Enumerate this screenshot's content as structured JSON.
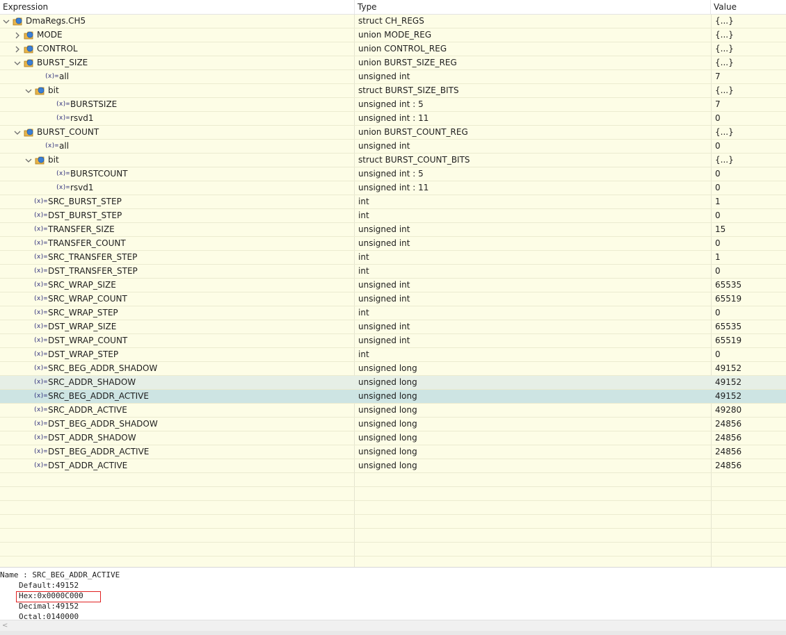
{
  "columns": {
    "expression": "Expression",
    "type": "Type",
    "value": "Value"
  },
  "rows": [
    {
      "name": "DmaRegs.CH5",
      "type": "struct CH_REGS",
      "value": "{...}",
      "depth": 0,
      "kind": "struct",
      "tw": "expanded"
    },
    {
      "name": "MODE",
      "type": "union MODE_REG",
      "value": "{...}",
      "depth": 1,
      "kind": "struct",
      "tw": "collapsed"
    },
    {
      "name": "CONTROL",
      "type": "union CONTROL_REG",
      "value": "{...}",
      "depth": 1,
      "kind": "struct",
      "tw": "collapsed"
    },
    {
      "name": "BURST_SIZE",
      "type": "union BURST_SIZE_REG",
      "value": "{...}",
      "depth": 1,
      "kind": "struct",
      "tw": "expanded"
    },
    {
      "name": "all",
      "type": "unsigned int",
      "value": "7",
      "depth": 2,
      "kind": "var",
      "tw": "none"
    },
    {
      "name": "bit",
      "type": "struct BURST_SIZE_BITS",
      "value": "{...}",
      "depth": 2,
      "kind": "struct",
      "tw": "expanded"
    },
    {
      "name": "BURSTSIZE",
      "type": "unsigned int : 5",
      "value": "7",
      "depth": 3,
      "kind": "var",
      "tw": "none"
    },
    {
      "name": "rsvd1",
      "type": "unsigned int : 11",
      "value": "0",
      "depth": 3,
      "kind": "var",
      "tw": "none"
    },
    {
      "name": "BURST_COUNT",
      "type": "union BURST_COUNT_REG",
      "value": "{...}",
      "depth": 1,
      "kind": "struct",
      "tw": "expanded"
    },
    {
      "name": "all",
      "type": "unsigned int",
      "value": "0",
      "depth": 2,
      "kind": "var",
      "tw": "none"
    },
    {
      "name": "bit",
      "type": "struct BURST_COUNT_BITS",
      "value": "{...}",
      "depth": 2,
      "kind": "struct",
      "tw": "expanded"
    },
    {
      "name": "BURSTCOUNT",
      "type": "unsigned int : 5",
      "value": "0",
      "depth": 3,
      "kind": "var",
      "tw": "none"
    },
    {
      "name": "rsvd1",
      "type": "unsigned int : 11",
      "value": "0",
      "depth": 3,
      "kind": "var",
      "tw": "none"
    },
    {
      "name": "SRC_BURST_STEP",
      "type": "int",
      "value": "1",
      "depth": 1,
      "kind": "var",
      "tw": "none"
    },
    {
      "name": "DST_BURST_STEP",
      "type": "int",
      "value": "0",
      "depth": 1,
      "kind": "var",
      "tw": "none"
    },
    {
      "name": "TRANSFER_SIZE",
      "type": "unsigned int",
      "value": "15",
      "depth": 1,
      "kind": "var",
      "tw": "none"
    },
    {
      "name": "TRANSFER_COUNT",
      "type": "unsigned int",
      "value": "0",
      "depth": 1,
      "kind": "var",
      "tw": "none"
    },
    {
      "name": "SRC_TRANSFER_STEP",
      "type": "int",
      "value": "1",
      "depth": 1,
      "kind": "var",
      "tw": "none"
    },
    {
      "name": "DST_TRANSFER_STEP",
      "type": "int",
      "value": "0",
      "depth": 1,
      "kind": "var",
      "tw": "none"
    },
    {
      "name": "SRC_WRAP_SIZE",
      "type": "unsigned int",
      "value": "65535",
      "depth": 1,
      "kind": "var",
      "tw": "none"
    },
    {
      "name": "SRC_WRAP_COUNT",
      "type": "unsigned int",
      "value": "65519",
      "depth": 1,
      "kind": "var",
      "tw": "none"
    },
    {
      "name": "SRC_WRAP_STEP",
      "type": "int",
      "value": "0",
      "depth": 1,
      "kind": "var",
      "tw": "none"
    },
    {
      "name": "DST_WRAP_SIZE",
      "type": "unsigned int",
      "value": "65535",
      "depth": 1,
      "kind": "var",
      "tw": "none"
    },
    {
      "name": "DST_WRAP_COUNT",
      "type": "unsigned int",
      "value": "65519",
      "depth": 1,
      "kind": "var",
      "tw": "none"
    },
    {
      "name": "DST_WRAP_STEP",
      "type": "int",
      "value": "0",
      "depth": 1,
      "kind": "var",
      "tw": "none"
    },
    {
      "name": "SRC_BEG_ADDR_SHADOW",
      "type": "unsigned long",
      "value": "49152",
      "depth": 1,
      "kind": "var",
      "tw": "none"
    },
    {
      "name": "SRC_ADDR_SHADOW",
      "type": "unsigned long",
      "value": "49152",
      "depth": 1,
      "kind": "var",
      "tw": "none",
      "state": "hover"
    },
    {
      "name": "SRC_BEG_ADDR_ACTIVE",
      "type": "unsigned long",
      "value": "49152",
      "depth": 1,
      "kind": "var",
      "tw": "none",
      "state": "selected"
    },
    {
      "name": "SRC_ADDR_ACTIVE",
      "type": "unsigned long",
      "value": "49280",
      "depth": 1,
      "kind": "var",
      "tw": "none"
    },
    {
      "name": "DST_BEG_ADDR_SHADOW",
      "type": "unsigned long",
      "value": "24856",
      "depth": 1,
      "kind": "var",
      "tw": "none"
    },
    {
      "name": "DST_ADDR_SHADOW",
      "type": "unsigned long",
      "value": "24856",
      "depth": 1,
      "kind": "var",
      "tw": "none"
    },
    {
      "name": "DST_BEG_ADDR_ACTIVE",
      "type": "unsigned long",
      "value": "24856",
      "depth": 1,
      "kind": "var",
      "tw": "none"
    },
    {
      "name": "DST_ADDR_ACTIVE",
      "type": "unsigned long",
      "value": "24856",
      "depth": 1,
      "kind": "var",
      "tw": "none"
    }
  ],
  "var_icon_text": "(x)=",
  "detail": {
    "name_line": "Name : SRC_BEG_ADDR_ACTIVE",
    "default_line": "Default:49152",
    "hex_line": "Hex:0x0000C000",
    "decimal_line": "Decimal:49152",
    "octal_line": "Octal:0140000"
  },
  "scroll_left_arrow": "<",
  "colors": {
    "row_bg": "#fdfde6",
    "selected_bg": "#cde4e3",
    "hover_bg": "#e6efe6",
    "highlight_box": "#e02020"
  }
}
